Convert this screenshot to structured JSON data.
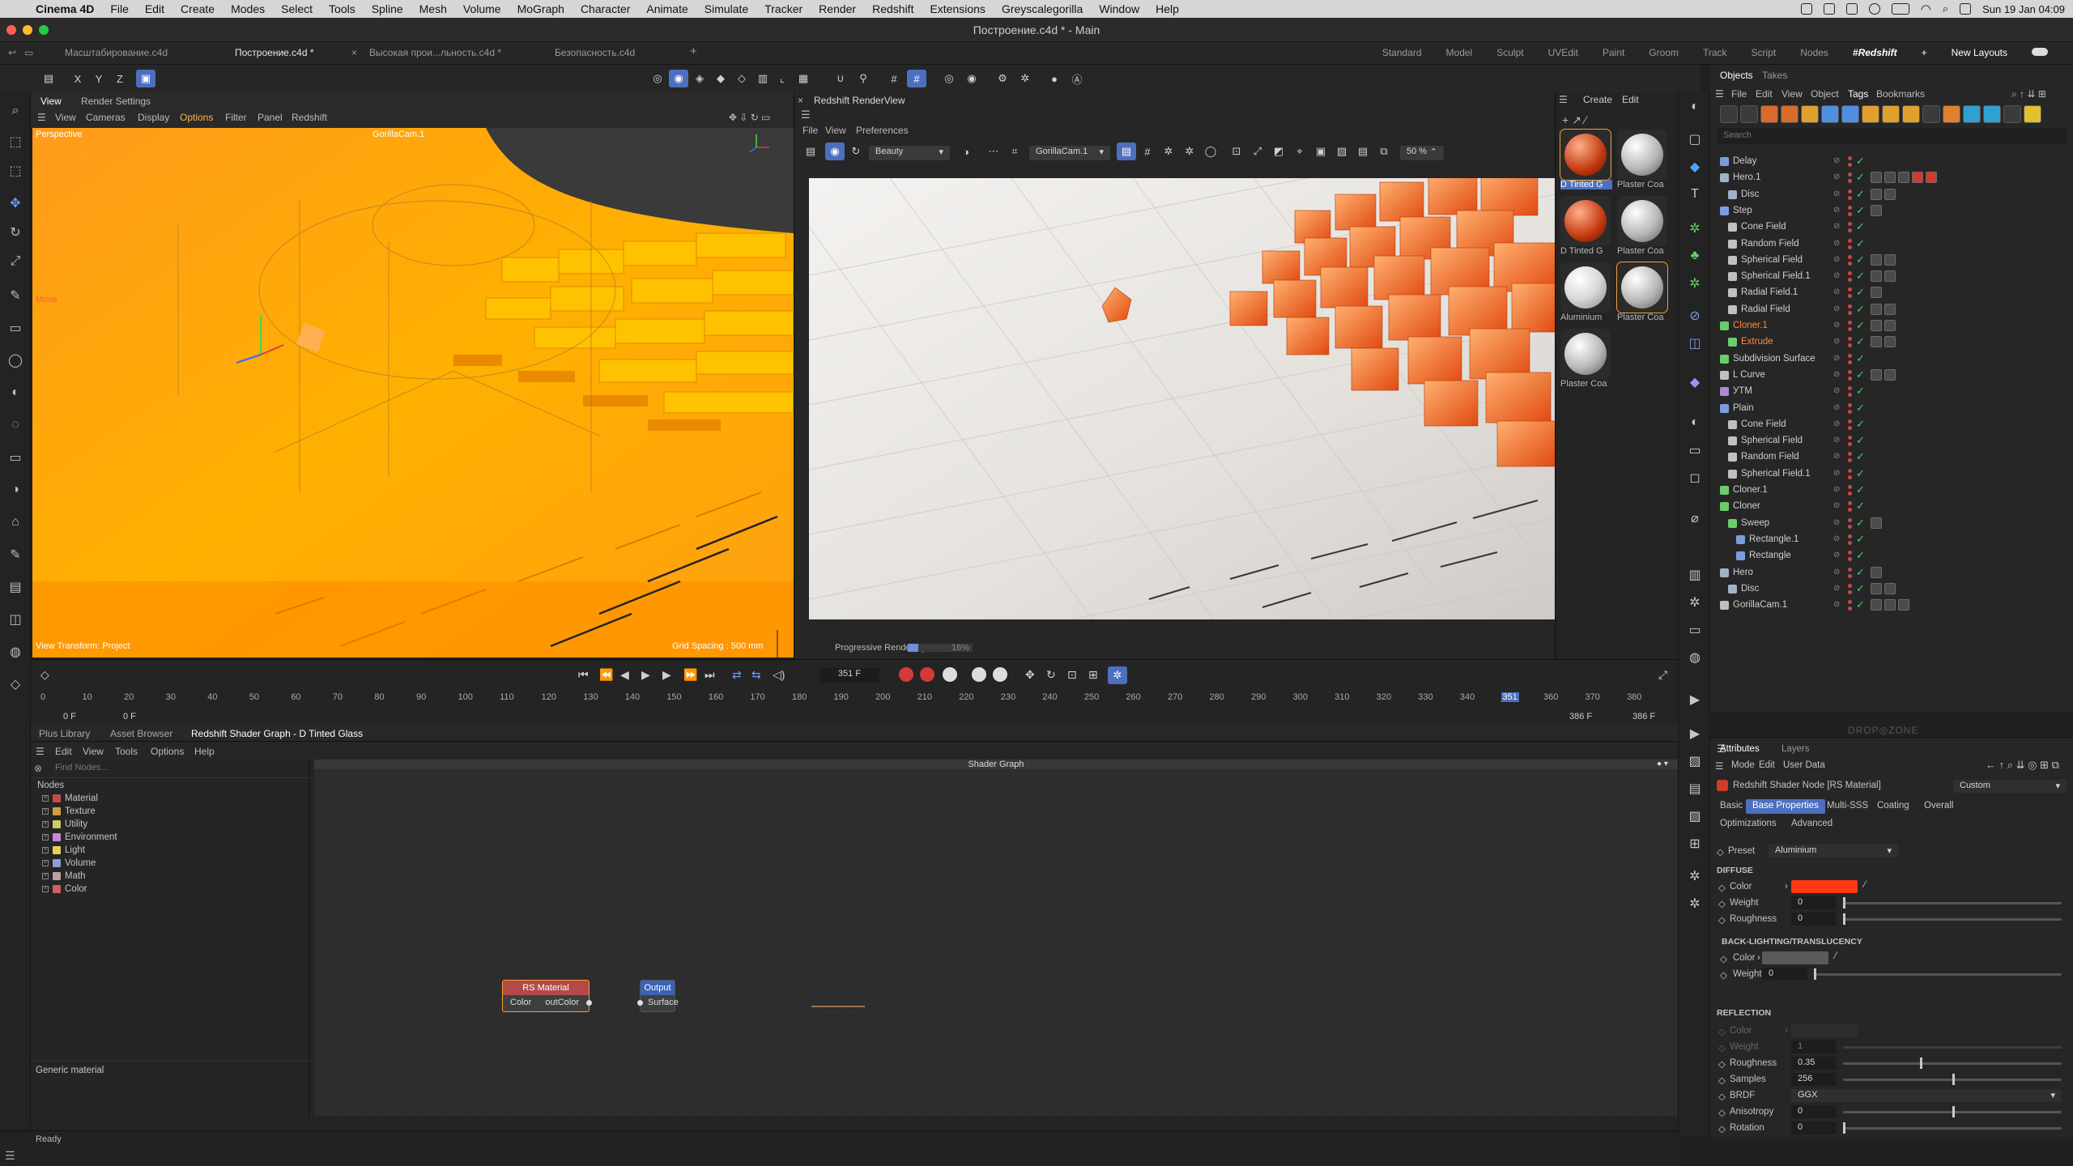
{
  "menubar": {
    "app_name": "Cinema 4D",
    "items": [
      "File",
      "Edit",
      "Create",
      "Modes",
      "Select",
      "Tools",
      "Spline",
      "Mesh",
      "Volume",
      "MoGraph",
      "Character",
      "Animate",
      "Simulate",
      "Tracker",
      "Render",
      "Redshift",
      "Extensions",
      "Greyscalegorilla",
      "Window",
      "Help"
    ],
    "clock": "Sun 19 Jan  04:09"
  },
  "window": {
    "title": "Построение.c4d * - Main"
  },
  "doc_tabs": [
    {
      "label": "Масштабирование.c4d",
      "active": false
    },
    {
      "label": "Построение.c4d *",
      "active": true
    },
    {
      "label": "Высокая прои...льность.c4d *",
      "active": false
    },
    {
      "label": "Безопасность.c4d",
      "active": false
    }
  ],
  "layouts": [
    "Standard",
    "Model",
    "Sculpt",
    "UVEdit",
    "Paint",
    "Groom",
    "Track",
    "Script",
    "Nodes",
    "#Redshift",
    "+",
    "New Layouts"
  ],
  "toolbar": {
    "axes": [
      "X",
      "Y",
      "Z"
    ]
  },
  "viewport": {
    "tabs": [
      "View",
      "Render Settings"
    ],
    "menu": [
      "View",
      "Cameras",
      "Display",
      "Options",
      "Filter",
      "Panel",
      "Redshift"
    ],
    "label": "Perspective",
    "camera": "GorillaCam.1",
    "move_label": "Move",
    "view_transform": "View Transform: Project",
    "grid_spacing": "Grid Spacing : 500 mm"
  },
  "renderview": {
    "title": "Redshift RenderView",
    "menu": [
      "File",
      "View",
      "Preferences"
    ],
    "aov": "Beauty",
    "camera": "GorillaCam.1",
    "zoom": "50 %",
    "progress_label": "Progressive Rendering...",
    "progress_pct": "16%",
    "progress_value": 0.16
  },
  "materials": {
    "menu": [
      "Create",
      "Edit"
    ],
    "items": [
      {
        "label": "D Tinted G",
        "kind": "orange"
      },
      {
        "label": "Plaster Coa",
        "kind": "grey"
      },
      {
        "label": "D Tinted G",
        "kind": "orange"
      },
      {
        "label": "Plaster Coa",
        "kind": "grey"
      },
      {
        "label": "Aluminium",
        "kind": "silver"
      },
      {
        "label": "Plaster Coa",
        "kind": "grey"
      },
      {
        "label": "Plaster Coa",
        "kind": "grey"
      }
    ]
  },
  "objects": {
    "tabs": [
      "Objects",
      "Takes"
    ],
    "menu": [
      "File",
      "Edit",
      "View",
      "Object",
      "Tags",
      "Bookmarks"
    ],
    "search_placeholder": "Search",
    "rows": [
      {
        "name": "Delay",
        "depth": 0,
        "color": "#7b9de0"
      },
      {
        "name": "Hero.1",
        "depth": 0,
        "color": "#9fb2c9"
      },
      {
        "name": "Disc",
        "depth": 1,
        "color": "#9fb2c9"
      },
      {
        "name": "Step",
        "depth": 0,
        "color": "#7b9de0"
      },
      {
        "name": "Cone Field",
        "depth": 1,
        "color": "#c0c0c0"
      },
      {
        "name": "Random Field",
        "depth": 1,
        "color": "#c0c0c0"
      },
      {
        "name": "Spherical Field",
        "depth": 1,
        "color": "#c0c0c0"
      },
      {
        "name": "Spherical Field.1",
        "depth": 1,
        "color": "#c0c0c0"
      },
      {
        "name": "Radial Field.1",
        "depth": 1,
        "color": "#c0c0c0"
      },
      {
        "name": "Radial Field",
        "depth": 1,
        "color": "#c0c0c0"
      },
      {
        "name": "Cloner.1",
        "depth": 0,
        "color": "#6bcc6b",
        "text_color": "#ff8a3a"
      },
      {
        "name": "Extrude",
        "depth": 1,
        "color": "#6bcc6b",
        "text_color": "#ff8a3a"
      },
      {
        "name": "Subdivision Surface",
        "depth": 0,
        "color": "#6bcc6b"
      },
      {
        "name": "L Curve",
        "depth": 0,
        "color": "#c0c0c0"
      },
      {
        "name": "УТМ",
        "depth": 0,
        "color": "#a98bd6"
      },
      {
        "name": "Plain",
        "depth": 0,
        "color": "#7b9de0"
      },
      {
        "name": "Cone Field",
        "depth": 1,
        "color": "#c0c0c0"
      },
      {
        "name": "Spherical Field",
        "depth": 1,
        "color": "#c0c0c0"
      },
      {
        "name": "Random Field",
        "depth": 1,
        "color": "#c0c0c0"
      },
      {
        "name": "Spherical Field.1",
        "depth": 1,
        "color": "#c0c0c0"
      },
      {
        "name": "Cloner.1",
        "depth": 0,
        "color": "#6bcc6b"
      },
      {
        "name": "Cloner",
        "depth": 0,
        "color": "#6bcc6b"
      },
      {
        "name": "Sweep",
        "depth": 1,
        "color": "#6bcc6b"
      },
      {
        "name": "Rectangle.1",
        "depth": 2,
        "color": "#7b9de0"
      },
      {
        "name": "Rectangle",
        "depth": 2,
        "color": "#7b9de0"
      },
      {
        "name": "Hero",
        "depth": 0,
        "color": "#9fb2c9"
      },
      {
        "name": "Disc",
        "depth": 1,
        "color": "#9fb2c9"
      },
      {
        "name": "GorillaCam.1",
        "depth": 0,
        "color": "#c0c0c0"
      }
    ]
  },
  "attributes": {
    "tabs": [
      "Attributes",
      "Layers"
    ],
    "menu": [
      "Mode",
      "Edit",
      "User Data"
    ],
    "node_title": "Redshift Shader Node [RS Material]",
    "preset_mode": "Custom",
    "tabs_row1": [
      "Basic",
      "Base Properties",
      "Multi-SSS",
      "Coating",
      "Overall"
    ],
    "tabs_row2": [
      "Optimizations",
      "Advanced"
    ],
    "preset_label": "Preset",
    "preset_value": "Aluminium",
    "diffuse": {
      "heading": "DIFFUSE",
      "color_label": "Color",
      "color_value": "#ff3a12",
      "weight_label": "Weight",
      "weight": "0",
      "roughness_label": "Roughness",
      "roughness": "0"
    },
    "backlight": {
      "heading": "BACK-LIGHTING/TRANSLUCENCY",
      "color_label": "Color",
      "weight_label": "Weight",
      "weight": "0"
    },
    "reflection": {
      "heading": "REFLECTION",
      "color_label": "Color",
      "weight_label": "Weight",
      "weight": "1",
      "roughness_label": "Roughness",
      "roughness": "0.35",
      "roughness_fill": 0.35,
      "samples_label": "Samples",
      "samples": "256",
      "samples_fill": 0.5,
      "brdf_label": "BRDF",
      "brdf": "GGX",
      "anisotropy_label": "Anisotropy",
      "anisotropy": "0",
      "anisotropy_fill": 0.5,
      "rotation_label": "Rotation",
      "rotation": "0",
      "rotation_fill": 0.0
    }
  },
  "timeline": {
    "current_frame": "351 F",
    "start": "0 F",
    "start2": "0 F",
    "end": "386 F",
    "end2": "386 F",
    "ticks": [
      "0",
      "10",
      "20",
      "30",
      "40",
      "50",
      "60",
      "70",
      "80",
      "90",
      "100",
      "110",
      "120",
      "130",
      "140",
      "150",
      "160",
      "170",
      "180",
      "190",
      "200",
      "210",
      "220",
      "230",
      "240",
      "250",
      "260",
      "270",
      "280",
      "290",
      "300",
      "310",
      "320",
      "330",
      "340",
      "350",
      "360",
      "370",
      "380"
    ],
    "playhead": "351"
  },
  "bottom": {
    "tabs": [
      "Plus Library",
      "Asset Browser",
      "Redshift Shader Graph - D Tinted Glass"
    ],
    "menu": [
      "Edit",
      "View",
      "Tools",
      "Options",
      "Help"
    ],
    "find_placeholder": "Find Nodes...",
    "nodes_heading": "Nodes",
    "node_categories": [
      {
        "label": "Material",
        "color": "#c44b4b"
      },
      {
        "label": "Texture",
        "color": "#d0a040"
      },
      {
        "label": "Utility",
        "color": "#cccc66"
      },
      {
        "label": "Environment",
        "color": "#c58ad6"
      },
      {
        "label": "Light",
        "color": "#e8d050"
      },
      {
        "label": "Volume",
        "color": "#8aa0d6"
      },
      {
        "label": "Math",
        "color": "#c0a0a0"
      },
      {
        "label": "Color",
        "color": "#d06060"
      }
    ],
    "description": "Generic material",
    "graph_title": "Shader Graph",
    "node_rs": {
      "title": "RS Material",
      "in": "Color",
      "out": "outColor"
    },
    "node_out": {
      "title": "Output",
      "in": "Surface"
    }
  },
  "status": {
    "text": "Ready"
  },
  "colors": {
    "accent": "#4d6fbf",
    "orange_vp": "#ffb300"
  }
}
